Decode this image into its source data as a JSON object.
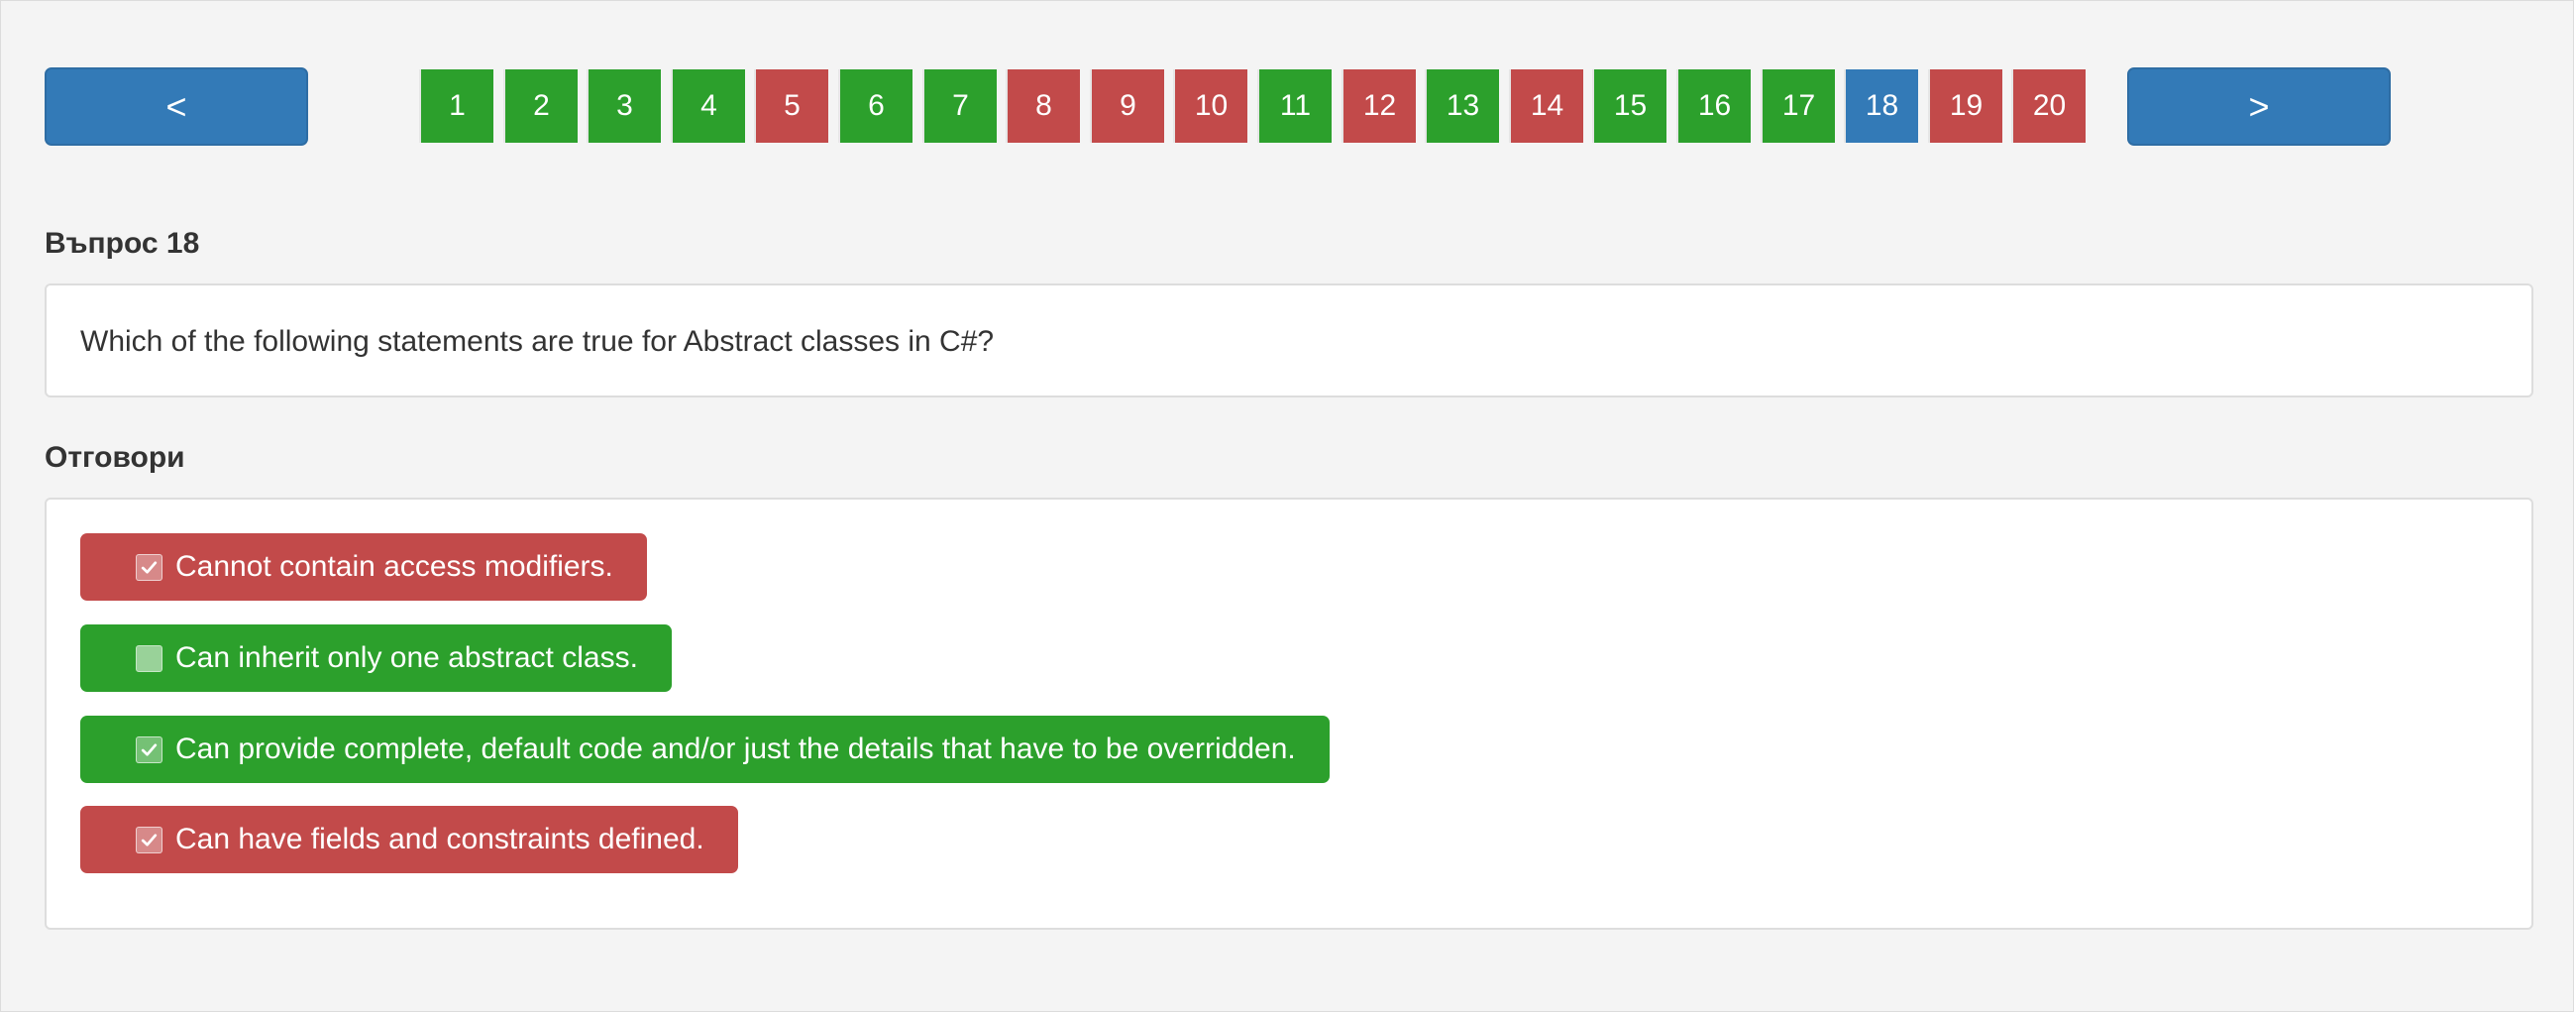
{
  "nav": {
    "prev_label": "<",
    "next_label": ">"
  },
  "pager": {
    "questions": [
      {
        "label": "1",
        "status": "correct"
      },
      {
        "label": "2",
        "status": "correct"
      },
      {
        "label": "3",
        "status": "correct"
      },
      {
        "label": "4",
        "status": "correct"
      },
      {
        "label": "5",
        "status": "wrong"
      },
      {
        "label": "6",
        "status": "correct"
      },
      {
        "label": "7",
        "status": "correct"
      },
      {
        "label": "8",
        "status": "wrong"
      },
      {
        "label": "9",
        "status": "wrong"
      },
      {
        "label": "10",
        "status": "wrong"
      },
      {
        "label": "11",
        "status": "correct"
      },
      {
        "label": "12",
        "status": "wrong"
      },
      {
        "label": "13",
        "status": "correct"
      },
      {
        "label": "14",
        "status": "wrong"
      },
      {
        "label": "15",
        "status": "correct"
      },
      {
        "label": "16",
        "status": "correct"
      },
      {
        "label": "17",
        "status": "correct"
      },
      {
        "label": "18",
        "status": "current"
      },
      {
        "label": "19",
        "status": "wrong"
      },
      {
        "label": "20",
        "status": "wrong"
      }
    ]
  },
  "question": {
    "heading": "Въпрос 18",
    "text": "Which of the following statements are true for Abstract classes in C#?"
  },
  "answers": {
    "heading": "Отговори",
    "items": [
      {
        "text": "Cannot contain access modifiers.",
        "checked": true,
        "status": "wrong"
      },
      {
        "text": "Can inherit only one abstract class.",
        "checked": false,
        "status": "correct"
      },
      {
        "text": "Can provide complete, default code and/or just the details that have to be overridden.",
        "checked": true,
        "status": "correct"
      },
      {
        "text": "Can have fields and constraints defined.",
        "checked": true,
        "status": "wrong"
      }
    ]
  },
  "colors": {
    "correct": "#2ca02c",
    "wrong": "#c24a4a",
    "current": "#337ab7",
    "nav_button": "#337ab7"
  },
  "icons": {
    "checked": "checkmark-icon",
    "unchecked": "empty-checkbox-icon"
  }
}
